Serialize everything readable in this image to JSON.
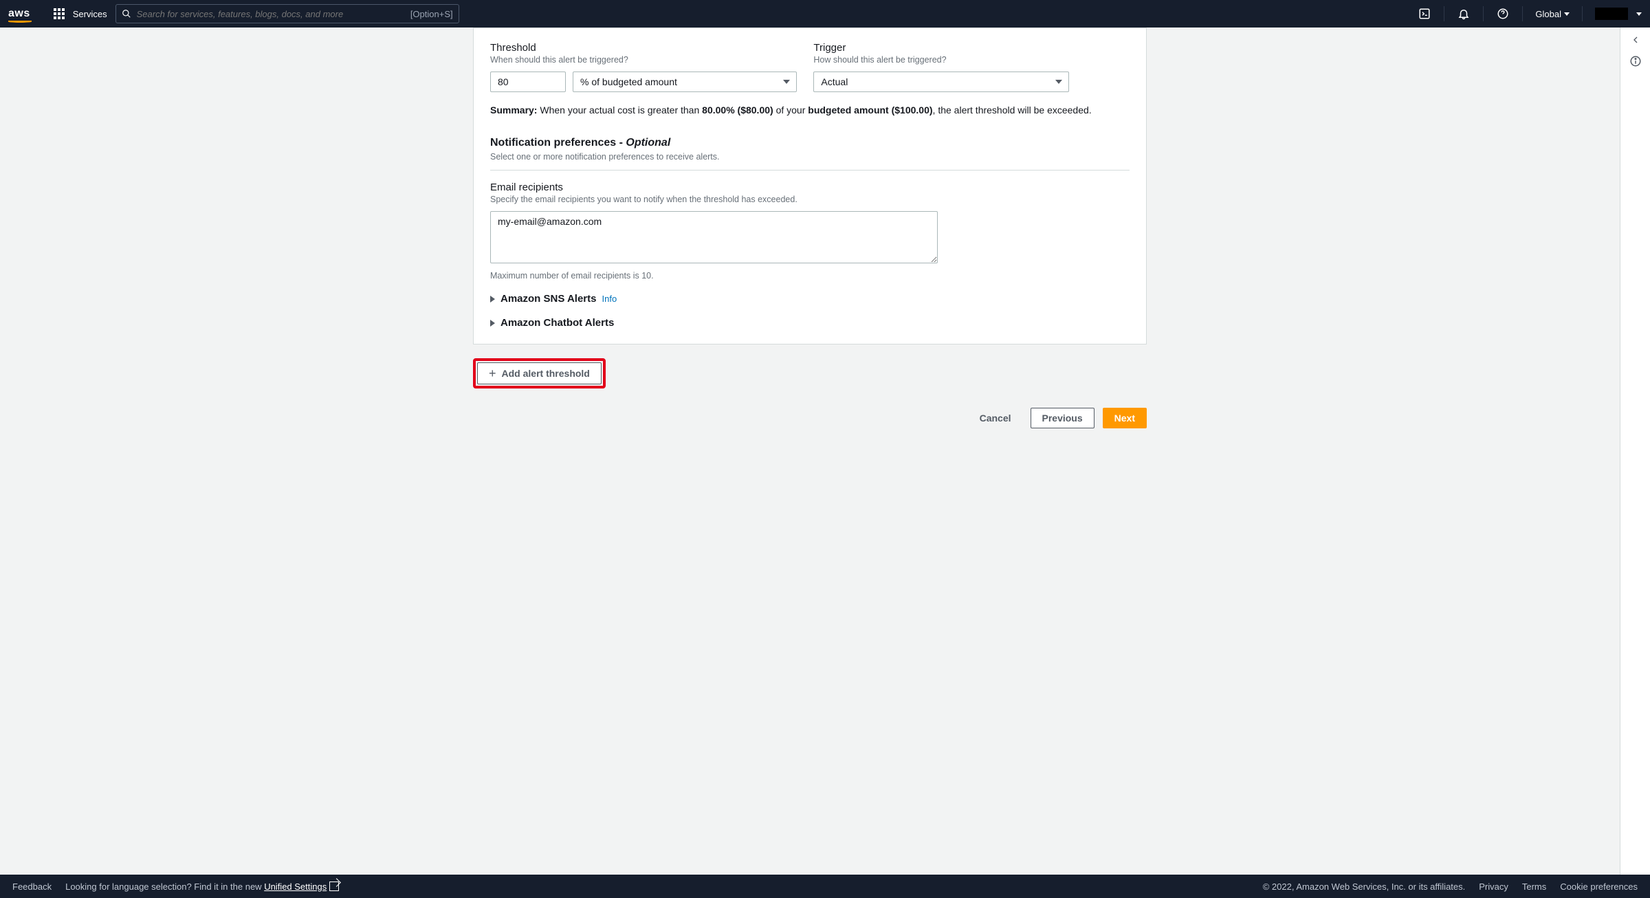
{
  "topnav": {
    "logo": "aws",
    "services": "Services",
    "search_placeholder": "Search for services, features, blogs, docs, and more",
    "search_shortcut": "[Option+S]",
    "region": "Global"
  },
  "form": {
    "threshold_label": "Threshold",
    "threshold_sub": "When should this alert be triggered?",
    "threshold_value": "80",
    "threshold_unit": "% of budgeted amount",
    "trigger_label": "Trigger",
    "trigger_sub": "How should this alert be triggered?",
    "trigger_value": "Actual",
    "summary_label": "Summary:",
    "summary_pre": " When your actual cost is greater than ",
    "summary_pct": "80.00% ($80.00)",
    "summary_mid": " of your ",
    "summary_budget": "budgeted amount ($100.00)",
    "summary_post": ", the alert threshold will be exceeded.",
    "notif_title": "Notification preferences - ",
    "notif_opt": "Optional",
    "notif_sub": "Select one or more notification preferences to receive alerts.",
    "email_label": "Email recipients",
    "email_sub": "Specify the email recipients you want to notify when the threshold has exceeded.",
    "email_value": "my-email@amazon.com",
    "email_helper": "Maximum number of email recipients is 10.",
    "exp_sns": "Amazon SNS Alerts",
    "exp_sns_info": "Info",
    "exp_chatbot": "Amazon Chatbot Alerts",
    "add_threshold": "Add alert threshold"
  },
  "actions": {
    "cancel": "Cancel",
    "previous": "Previous",
    "next": "Next"
  },
  "footer": {
    "feedback": "Feedback",
    "lang_prompt": "Looking for language selection? Find it in the new ",
    "unified": "Unified Settings",
    "copyright": "© 2022, Amazon Web Services, Inc. or its affiliates.",
    "privacy": "Privacy",
    "terms": "Terms",
    "cookies": "Cookie preferences"
  }
}
